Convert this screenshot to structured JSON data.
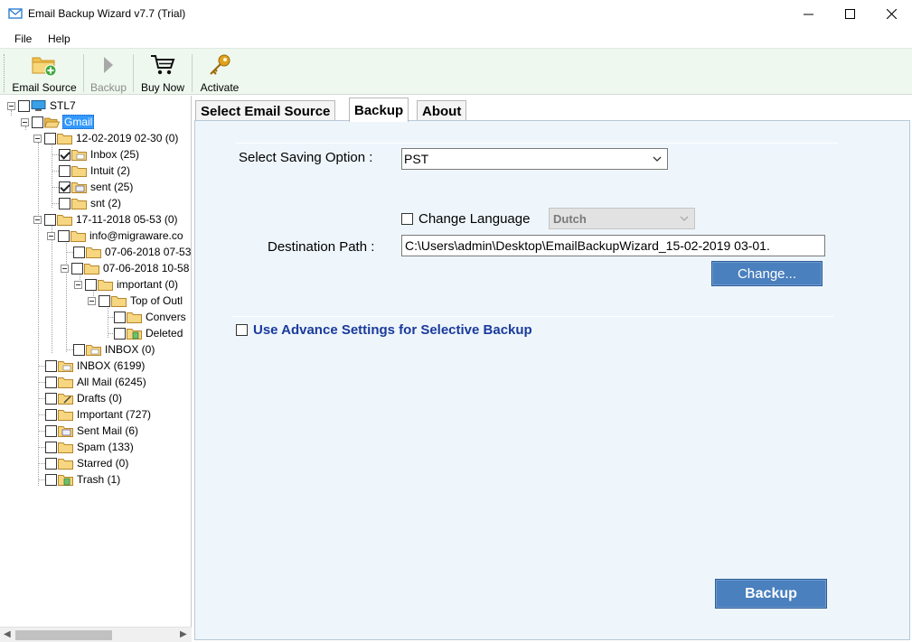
{
  "window": {
    "title": "Email Backup Wizard v7.7 (Trial)"
  },
  "menu": [
    "File",
    "Help"
  ],
  "toolbar": {
    "email_source": "Email Source",
    "backup": "Backup",
    "buy_now": "Buy Now",
    "activate": "Activate"
  },
  "tree": [
    {
      "label": "STL7"
    },
    {
      "label": "Gmail"
    },
    {
      "label": "12-02-2019 02-30 (0)"
    },
    {
      "label": "Inbox (25)",
      "checked": true
    },
    {
      "label": "Intuit (2)"
    },
    {
      "label": "sent (25)",
      "checked": true
    },
    {
      "label": "snt (2)"
    },
    {
      "label": "17-11-2018 05-53 (0)"
    },
    {
      "label": "info@migraware.co"
    },
    {
      "label": "07-06-2018 07-53"
    },
    {
      "label": "07-06-2018 10-58"
    },
    {
      "label": "important (0)"
    },
    {
      "label": "Top of Outl"
    },
    {
      "label": "Convers"
    },
    {
      "label": "Deleted"
    },
    {
      "label": "INBOX (0)"
    },
    {
      "label": "INBOX (6199)"
    },
    {
      "label": "All Mail (6245)"
    },
    {
      "label": "Drafts (0)"
    },
    {
      "label": "Important (727)"
    },
    {
      "label": "Sent Mail (6)"
    },
    {
      "label": "Spam (133)"
    },
    {
      "label": "Starred (0)"
    },
    {
      "label": "Trash (1)"
    }
  ],
  "tabs": [
    "Select Email Source",
    "Backup",
    "About"
  ],
  "backup": {
    "saving_option_label": "Select Saving Option :",
    "saving_option_value": "PST",
    "change_language_label": "Change Language",
    "language_value": "Dutch",
    "destination_label": "Destination Path :",
    "destination_value": "C:\\Users\\admin\\Desktop\\EmailBackupWizard_15-02-2019 03-01.",
    "change_button": "Change...",
    "advance_label": "Use Advance Settings for Selective Backup",
    "backup_button": "Backup"
  },
  "colors": {
    "toolbar_bg": "#eef8ee",
    "panel_bg": "#eef6fc",
    "button_blue": "#4a80bd",
    "advance_text": "#1a3a9c",
    "selection": "#3399ff"
  }
}
